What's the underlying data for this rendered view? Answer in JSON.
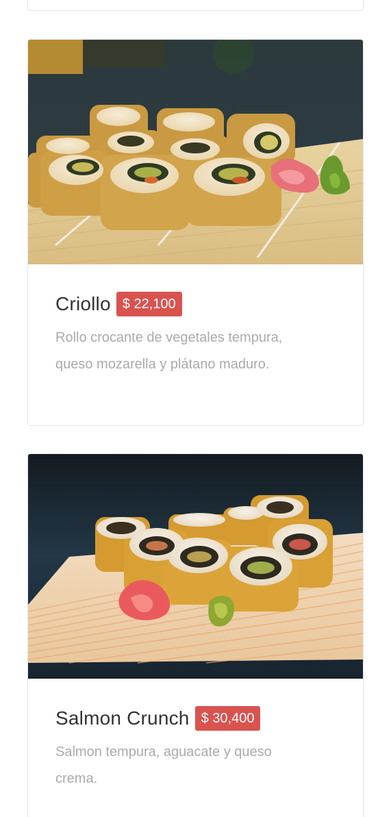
{
  "menu": {
    "items": [
      {
        "name": "Criollo",
        "price": "$ 22,100",
        "description": "Rollo crocante de vegetales tempura, queso mozarella y plátano maduro.",
        "image_alt": "Criollo sushi roll photo"
      },
      {
        "name": "Salmon Crunch",
        "price": "$ 30,400",
        "description": "Salmon tempura, aguacate y queso crema.",
        "image_alt": "Salmon Crunch sushi roll photo"
      }
    ]
  },
  "colors": {
    "price_badge": "#d9534f",
    "title_text": "#333333",
    "description_text": "#aaaaaa",
    "card_border": "#e6e6e6"
  }
}
